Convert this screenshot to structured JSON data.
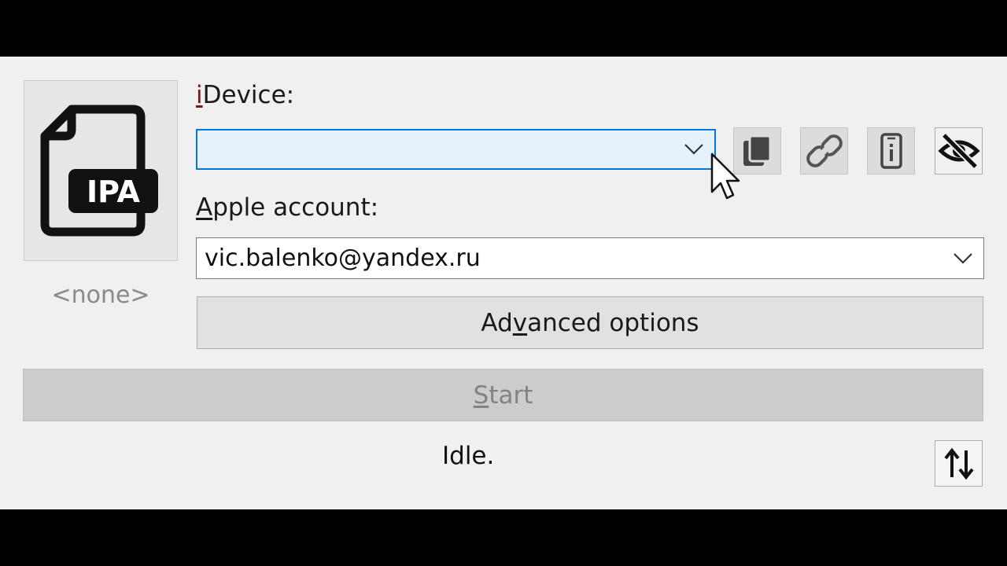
{
  "ipa": {
    "icon_text": "IPA",
    "icon": "ipa-file-icon",
    "name": "<none>"
  },
  "idevice": {
    "label_accel": "i",
    "label_rest": "Device:",
    "value": ""
  },
  "toolbar": {
    "icons": [
      "copy-icon",
      "unlink-icon",
      "device-info-icon",
      "eye-off-icon"
    ]
  },
  "apple_account": {
    "label_accel": "A",
    "label_rest": "pple account:",
    "value": "vic.balenko@yandex.ru"
  },
  "advanced": {
    "label_pre": "Ad",
    "label_accel": "v",
    "label_post": "anced options"
  },
  "start": {
    "label_accel": "S",
    "label_post": "tart",
    "enabled": false
  },
  "status": {
    "text": "Idle."
  },
  "sort_button": {
    "icon": "sort-arrows-icon"
  },
  "colors": {
    "window_bg": "#f0f0f0",
    "focus_border": "#0078d7",
    "focus_fill": "#e5f1fb",
    "disabled_text": "#838383"
  }
}
